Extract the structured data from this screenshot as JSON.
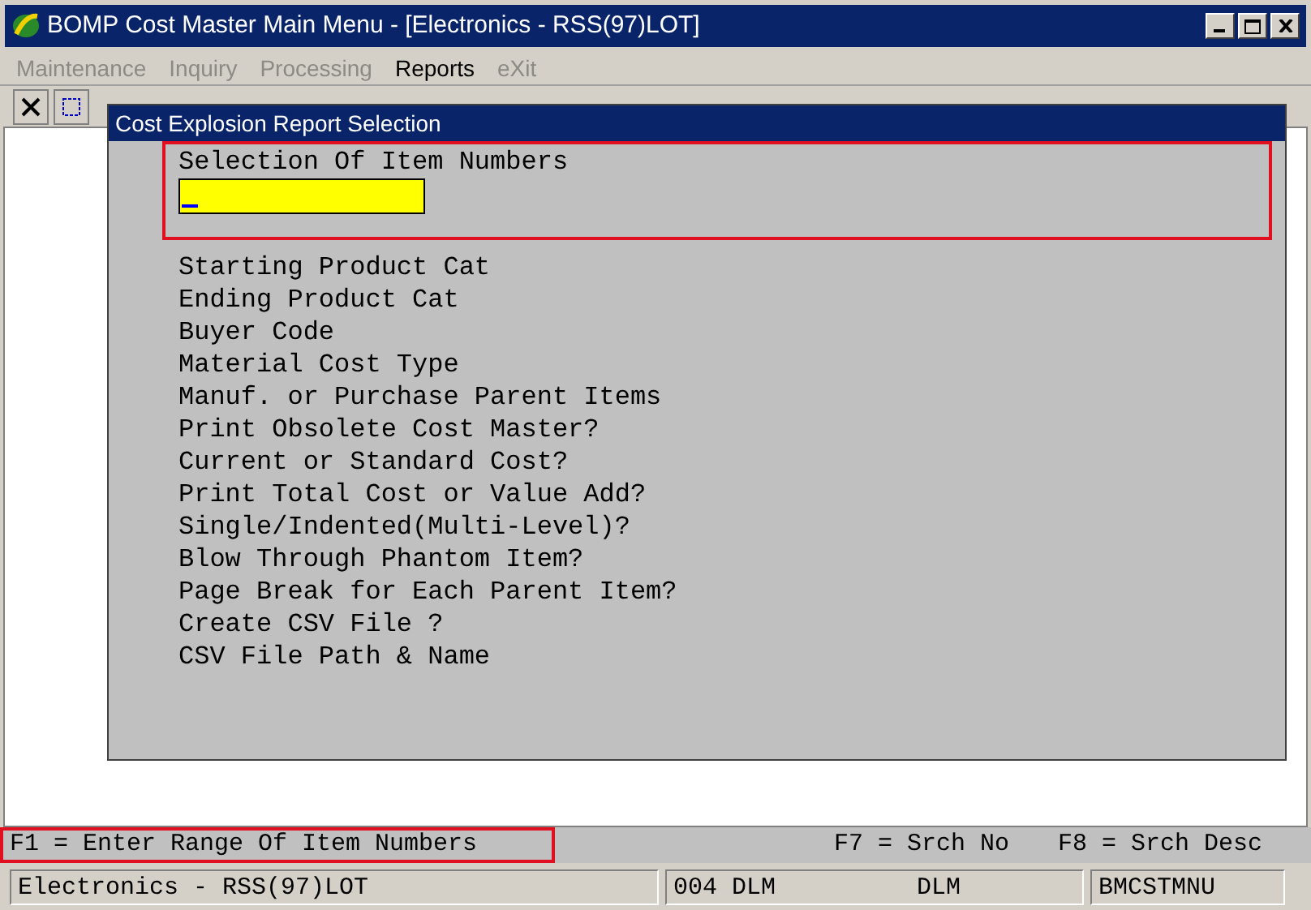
{
  "window": {
    "title": "BOMP Cost Master Main Menu - [Electronics - RSS(97)LOT]"
  },
  "menu": [
    {
      "label": "Maintenance",
      "disabled": true
    },
    {
      "label": "Inquiry",
      "disabled": true
    },
    {
      "label": "Processing",
      "disabled": true
    },
    {
      "label": "Reports",
      "disabled": false
    },
    {
      "label": "eXit",
      "disabled": true
    }
  ],
  "dialog": {
    "title": "Cost Explosion Report Selection",
    "selection": {
      "label": "Selection Of Item Numbers",
      "highlighted": true
    },
    "prompts": [
      "Starting Product Cat",
      "Ending Product Cat",
      "Buyer Code",
      "Material Cost Type",
      "Manuf. or Purchase Parent Items",
      "Print Obsolete Cost Master?",
      "Current or Standard Cost?",
      "Print Total Cost or Value Add?",
      "Single/Indented(Multi-Level)?",
      "Blow Through Phantom Item?",
      "Page Break for Each Parent Item?",
      "Create CSV File ?",
      "CSV File Path & Name"
    ]
  },
  "key_bar": {
    "hint": {
      "text": "F1 = Enter Range Of Item Numbers",
      "highlighted": true
    },
    "keys": [
      "F7 = Srch No",
      "F8 = Srch Desc"
    ]
  },
  "status_bar": [
    "Electronics - RSS(97)LOT",
    "004 DLM",
    "DLM",
    "BMCSTMNU"
  ]
}
